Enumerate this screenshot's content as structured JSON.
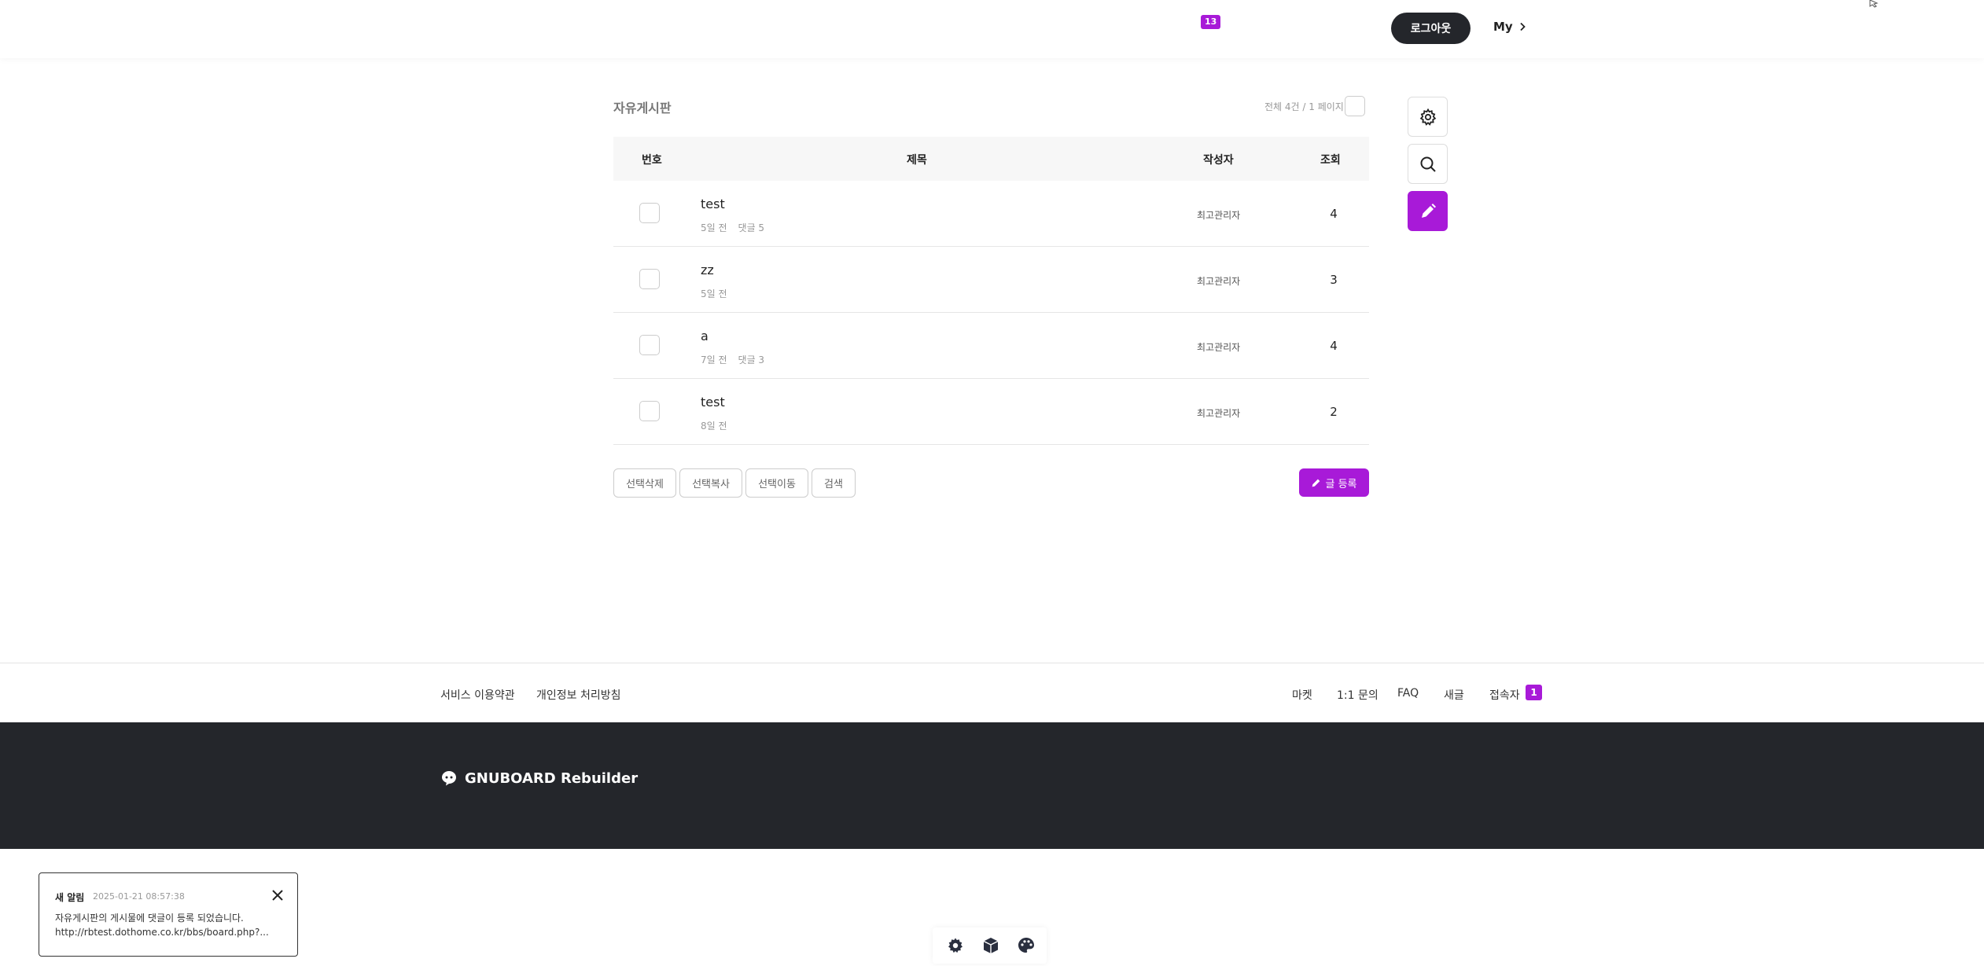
{
  "header": {
    "notification_count": "13",
    "logout_label": "로그아웃",
    "my_label": "My"
  },
  "board": {
    "title": "자유게시판",
    "count_text": "전체 4건 / 1 페이지",
    "columns": {
      "num": "번호",
      "subject": "제목",
      "author": "작성자",
      "views": "조회"
    },
    "rows": [
      {
        "title": "test",
        "date": "5일 전",
        "comments": "댓글 5",
        "author": "최고관리자",
        "views": "4"
      },
      {
        "title": "zz",
        "date": "5일 전",
        "comments": "",
        "author": "최고관리자",
        "views": "3"
      },
      {
        "title": "a",
        "date": "7일 전",
        "comments": "댓글 3",
        "author": "최고관리자",
        "views": "4"
      },
      {
        "title": "test",
        "date": "8일 전",
        "comments": "",
        "author": "최고관리자",
        "views": "2"
      }
    ],
    "actions": {
      "delete_label": "선택삭제",
      "copy_label": "선택복사",
      "move_label": "선택이동",
      "search_label": "검색",
      "write_label": "글 등록"
    }
  },
  "side_tools": [
    "gear-icon",
    "search-icon",
    "pencil-icon"
  ],
  "footer": {
    "left_links": [
      "서비스 이용약관",
      "개인정보 처리방침"
    ],
    "right_links": [
      "마켓",
      "1:1 문의",
      "FAQ",
      "새글",
      "접속자"
    ],
    "visitor_count": "1",
    "brand": "GNUBOARD Rebuilder"
  },
  "toast": {
    "heading": "새 알림",
    "time": "2025-01-21 08:57:38",
    "message": "자유게시판의 게시물에 댓글이 등록 되었습니다.",
    "url": "http://rbtest.dothome.co.kr/bbs/board.php?..."
  },
  "bottom_bar": [
    "gear-icon",
    "cube-icon",
    "palette-icon"
  ],
  "colors": {
    "accent": "#a81ad8",
    "dark": "#24262b"
  }
}
